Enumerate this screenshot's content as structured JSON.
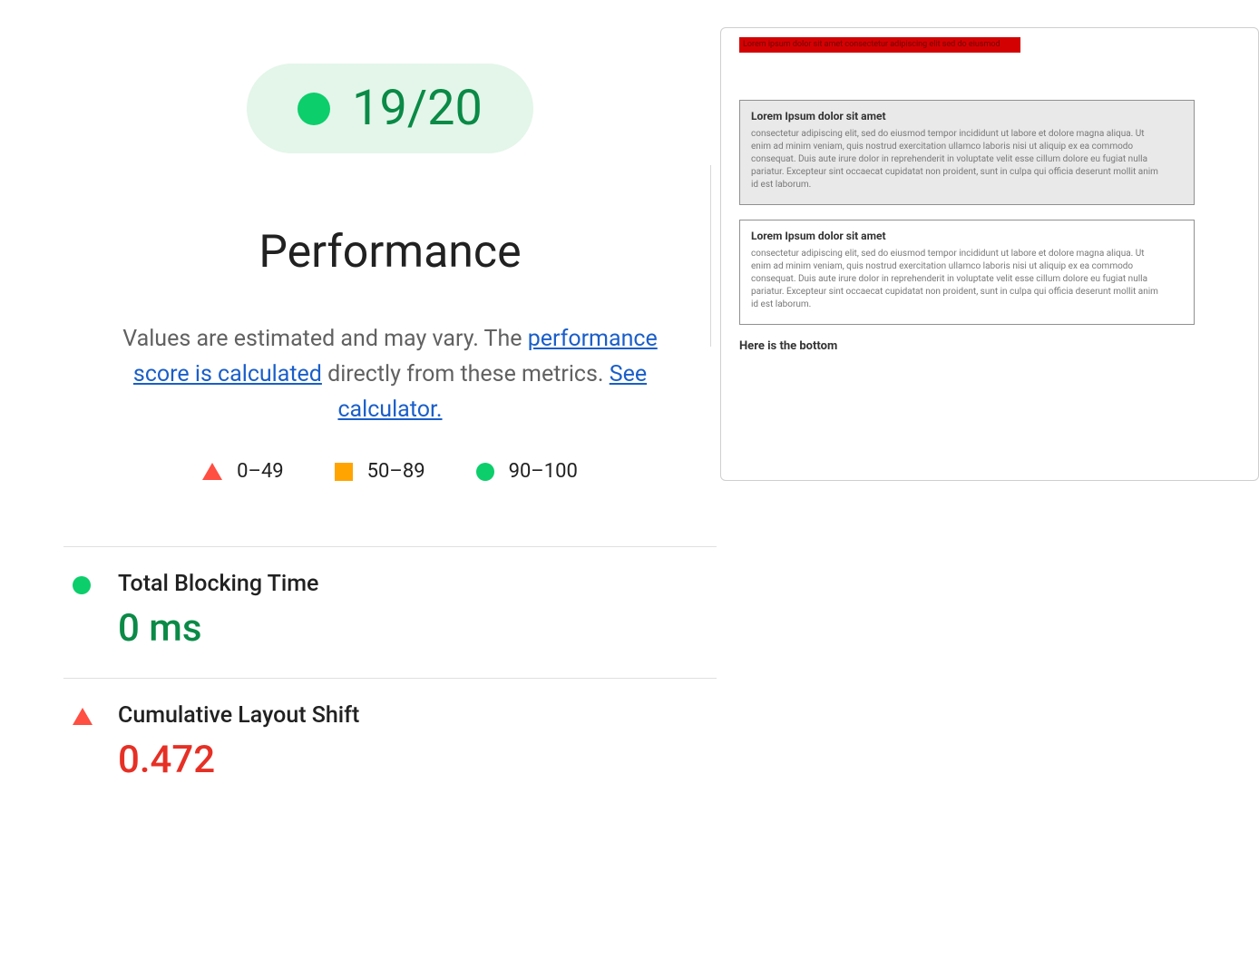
{
  "score": {
    "text": "19/20"
  },
  "heading": "Performance",
  "description": {
    "prefix": "Values are estimated and may vary. The ",
    "link1": "performance score is calculated",
    "middle": " directly from these metrics. ",
    "link2": "See calculator."
  },
  "legend": {
    "fail": "0–49",
    "average": "50–89",
    "pass": "90–100"
  },
  "metrics": [
    {
      "label": "Total Blocking Time",
      "value": "0 ms",
      "status": "pass"
    },
    {
      "label": "Cumulative Layout Shift",
      "value": "0.472",
      "status": "fail"
    }
  ],
  "thumbnail": {
    "banner_lines": "Lorem ipsum dolor sit amet consectetur adipiscing elit sed do eiusmod",
    "card_title": "Lorem Ipsum dolor sit amet",
    "card_body": "consectetur adipiscing elit, sed do eiusmod tempor incididunt ut labore et dolore magna aliqua. Ut enim ad minim veniam, quis nostrud exercitation ullamco laboris nisi ut aliquip ex ea commodo consequat. Duis aute irure dolor in reprehenderit in voluptate velit esse cillum dolore eu fugiat nulla pariatur. Excepteur sint occaecat cupidatat non proident, sunt in culpa qui officia deserunt mollit anim id est laborum.",
    "bottom": "Here is the bottom"
  }
}
